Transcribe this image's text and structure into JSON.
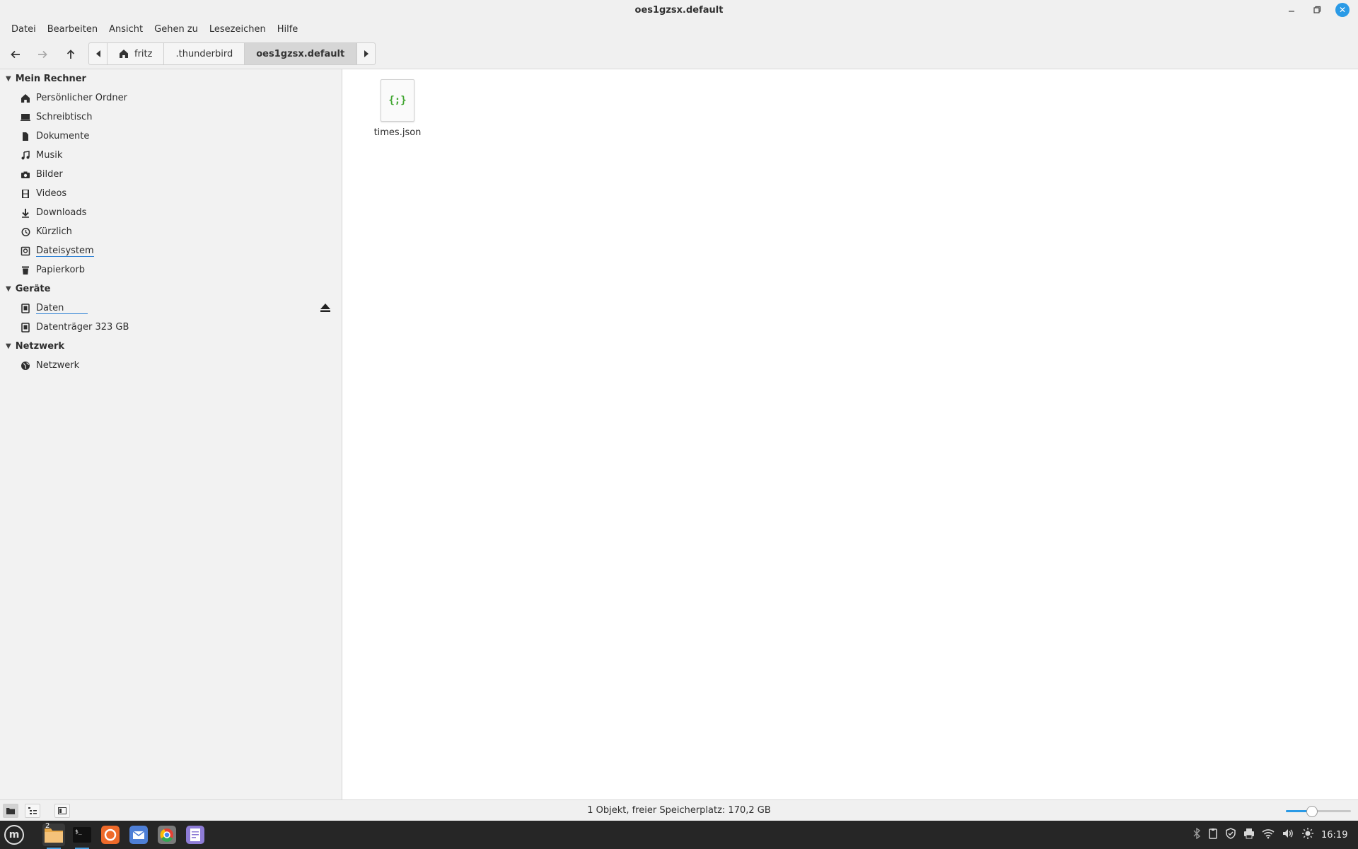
{
  "window": {
    "title": "oes1gzsx.default"
  },
  "menu": [
    "Datei",
    "Bearbeiten",
    "Ansicht",
    "Gehen zu",
    "Lesezeichen",
    "Hilfe"
  ],
  "pathbar": {
    "crumbs": [
      "fritz",
      ".thunderbird",
      "oes1gzsx.default"
    ],
    "active_index": 2
  },
  "sidebar": {
    "sections": [
      {
        "title": "Mein Rechner",
        "items": [
          {
            "label": "Persönlicher Ordner",
            "icon": "home-icon"
          },
          {
            "label": "Schreibtisch",
            "icon": "desktop-icon"
          },
          {
            "label": "Dokumente",
            "icon": "document-icon"
          },
          {
            "label": "Musik",
            "icon": "music-icon"
          },
          {
            "label": "Bilder",
            "icon": "camera-icon"
          },
          {
            "label": "Videos",
            "icon": "film-icon"
          },
          {
            "label": "Downloads",
            "icon": "download-icon"
          },
          {
            "label": "Kürzlich",
            "icon": "recent-icon"
          },
          {
            "label": "Dateisystem",
            "icon": "drive-icon"
          },
          {
            "label": "Papierkorb",
            "icon": "trash-icon"
          }
        ]
      },
      {
        "title": "Geräte",
        "items": [
          {
            "label": "Daten",
            "icon": "disk-icon"
          },
          {
            "label": "Datenträger 323 GB",
            "icon": "disk-icon"
          }
        ]
      },
      {
        "title": "Netzwerk",
        "items": [
          {
            "label": "Netzwerk",
            "icon": "network-icon"
          }
        ]
      }
    ]
  },
  "files": [
    {
      "name": "times.json",
      "icon_glyph": "{;}"
    }
  ],
  "status": {
    "text": "1 Objekt, freier Speicherplatz: 170,2 GB",
    "zoom_level": 0.4
  },
  "taskbar": {
    "clock": "16:19",
    "workspace_badge": "2"
  },
  "colors": {
    "accent": "#2a9ae6",
    "json_icon": "#3fa52f"
  }
}
